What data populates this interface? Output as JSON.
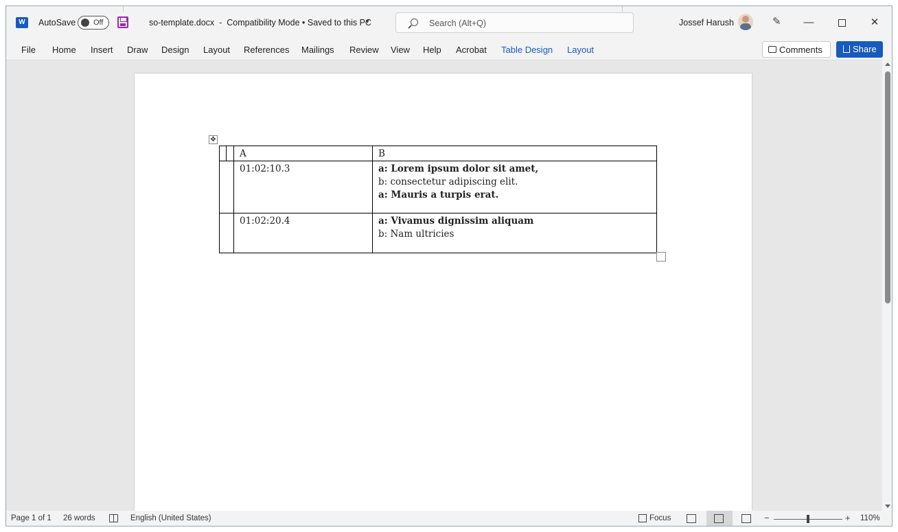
{
  "titlebar": {
    "app_icon": "word-logo",
    "autosave_label": "AutoSave",
    "autosave_state": "Off",
    "doc_title": "so-template.docx  -  Compatibility Mode • Saved to this PC",
    "search_placeholder": "Search (Alt+Q)",
    "user_name": "Jossef Harush",
    "pen_icon": "pen-sparkle-icon",
    "min_glyph": "—",
    "close_glyph": "✕"
  },
  "menu": {
    "items": [
      "File",
      "Home",
      "Insert",
      "Draw",
      "Design",
      "Layout",
      "References",
      "Mailings",
      "Review",
      "View",
      "Help",
      "Acrobat",
      "Table Design",
      "Layout"
    ],
    "comments_label": "Comments",
    "share_label": "Share"
  },
  "document": {
    "table": {
      "headers": [
        "A",
        "B"
      ],
      "rows": [
        {
          "time": "01:02:10.3",
          "lines": [
            {
              "text": "a: Lorem ipsum dolor sit amet,",
              "bold": true
            },
            {
              "text": "b: consectetur adipiscing elit.",
              "bold": false
            },
            {
              "text": "a: Mauris a turpis erat.",
              "bold": true
            }
          ]
        },
        {
          "time": "01:02:20.4",
          "lines": [
            {
              "text": "a: Vivamus dignissim aliquam",
              "bold": true
            },
            {
              "text": "b: Nam ultricies",
              "bold": false
            }
          ]
        }
      ]
    }
  },
  "statusbar": {
    "page": "Page 1 of 1",
    "words": "26 words",
    "language": "English (United States)",
    "focus_label": "Focus",
    "zoom": "110%"
  },
  "colors": {
    "accent": "#185abd",
    "save_icon": "#9c27b0"
  }
}
